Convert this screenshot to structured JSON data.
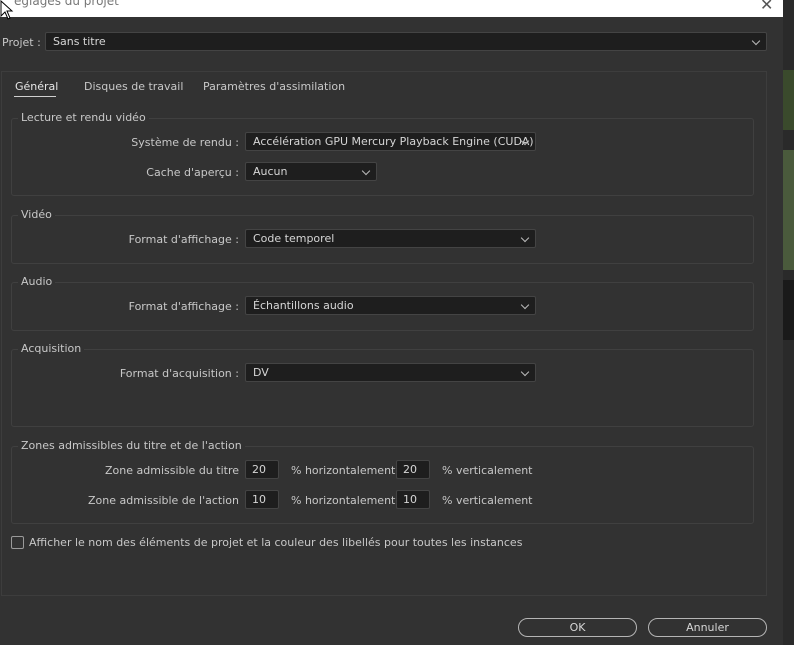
{
  "window": {
    "title": "églages du projet",
    "close_glyph": "✕"
  },
  "project": {
    "label": "Projet :",
    "value": "Sans titre"
  },
  "tabs": [
    {
      "label": "Général",
      "active": true
    },
    {
      "label": "Disques de travail",
      "active": false
    },
    {
      "label": "Paramètres d'assimilation",
      "active": false
    }
  ],
  "groups": {
    "playback": {
      "title": "Lecture et rendu vidéo",
      "renderer_label": "Système de rendu :",
      "renderer_value": "Accélération GPU Mercury Playback Engine (CUDA)",
      "cache_label": "Cache d'aperçu :",
      "cache_value": "Aucun"
    },
    "video": {
      "title": "Vidéo",
      "display_label": "Format d'affichage :",
      "display_value": "Code temporel"
    },
    "audio": {
      "title": "Audio",
      "display_label": "Format d'affichage :",
      "display_value": "Échantillons audio"
    },
    "capture": {
      "title": "Acquisition",
      "format_label": "Format d'acquisition :",
      "format_value": "DV"
    },
    "safe": {
      "title": "Zones admissibles du titre et de l'action",
      "title_label": "Zone admissible du titre",
      "title_h": "20",
      "title_v": "20",
      "action_label": "Zone admissible de l'action",
      "action_h": "10",
      "action_v": "10",
      "h_unit": "% horizontalement",
      "v_unit": "% verticalement"
    }
  },
  "option": {
    "label": "Afficher le nom des éléments de projet et la couleur des libellés pour toutes les instances",
    "checked": false
  },
  "buttons": {
    "ok": "OK",
    "cancel": "Annuler"
  }
}
